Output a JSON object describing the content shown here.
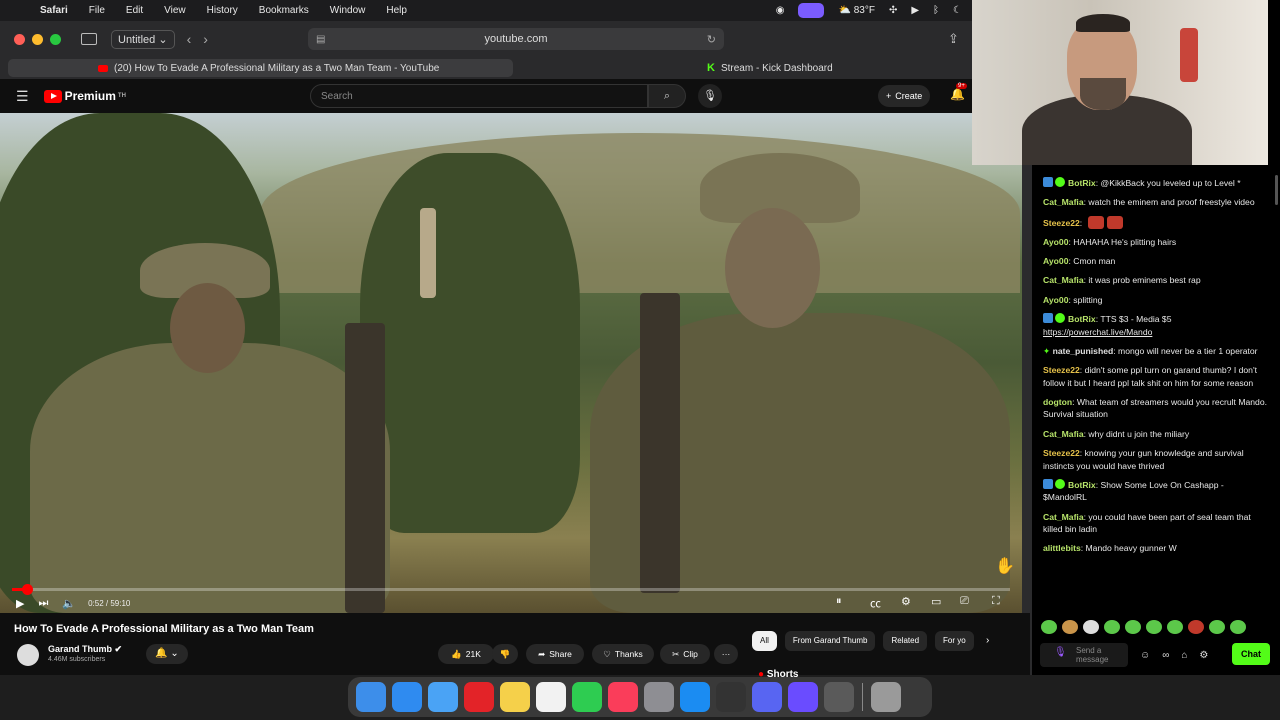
{
  "menubar": {
    "items": [
      "Safari",
      "File",
      "Edit",
      "View",
      "History",
      "Bookmarks",
      "Window",
      "Help"
    ],
    "weather": "83°F"
  },
  "browser": {
    "tab_group": "Untitled",
    "url": "youtube.com",
    "tabs": [
      {
        "title": "(20) How To Evade A Professional Military as a Two Man Team - YouTube",
        "active": true
      },
      {
        "title": "Stream - Kick Dashboard",
        "active": false
      }
    ]
  },
  "youtube": {
    "logo_text": "Premium",
    "logo_sup": "TH",
    "search_placeholder": "Search",
    "create_label": "Create",
    "notif_badge": "9+",
    "player": {
      "current_time": "0:52",
      "duration": "59:10",
      "time_display": "0:52 / 59:10",
      "progress_fraction": 0.0146
    },
    "video_title": "How To Evade A Professional Military as a Two Man Team",
    "channel_name": "Garand Thumb",
    "subscribers": "4.46M subscribers",
    "likes": "21K",
    "share_label": "Share",
    "thanks_label": "Thanks",
    "clip_label": "Clip",
    "more_label": "···",
    "chips": [
      "All",
      "From Garand Thumb",
      "Related",
      "For yo"
    ],
    "shorts_label": "Shorts"
  },
  "chat": {
    "messages": [
      {
        "user": "BotRix",
        "text": "@KikkBack you leveled up to Level *",
        "color": "#b7e36a",
        "badges": [
          "bot",
          "verified"
        ]
      },
      {
        "user": "Cat_Mafia",
        "text": "watch the eminem and proof freestyle video",
        "color": "#b7e36a",
        "badges": []
      },
      {
        "user": "Steeze22",
        "text": "",
        "color": "#e6c24a",
        "badges": [],
        "emotes": 2
      },
      {
        "user": "Ayo00",
        "text": "HAHAHA He's plitting hairs",
        "color": "#b7e36a",
        "badges": []
      },
      {
        "user": "Ayo00",
        "text": "Cmon man",
        "color": "#b7e36a",
        "badges": []
      },
      {
        "user": "Cat_Mafia",
        "text": "it was prob eminems best rap",
        "color": "#b7e36a",
        "badges": []
      },
      {
        "user": "Ayo00",
        "text": "splitting",
        "color": "#b7e36a",
        "badges": []
      },
      {
        "user": "BotRix",
        "text": "TTS $3 - Media $5",
        "link": "https://powerchat.live/Mando",
        "color": "#b7e36a",
        "badges": [
          "bot",
          "verified"
        ]
      },
      {
        "user": "nate_punished",
        "text": "mongo will never be a tier 1 operator",
        "color": "#e0e0e0",
        "badges": [
          "star"
        ]
      },
      {
        "user": "Steeze22",
        "text": "didn't some ppl turn on garand thumb? I don't follow it but I heard ppl talk shit on him for some reason",
        "color": "#e6c24a",
        "badges": []
      },
      {
        "user": "dogton",
        "text": "What team of streamers would you recrult Mando. Survival situation",
        "color": "#b7e36a",
        "badges": []
      },
      {
        "user": "Cat_Mafia",
        "text": "why didnt u join the miliary",
        "color": "#b7e36a",
        "badges": []
      },
      {
        "user": "Steeze22",
        "text": "knowing your gun knowledge and survival instincts you would have thrived",
        "color": "#e6c24a",
        "badges": []
      },
      {
        "user": "BotRix",
        "text": "Show Some Love On Cashapp - $MandolRL",
        "color": "#b7e36a",
        "badges": [
          "bot",
          "verified"
        ]
      },
      {
        "user": "Cat_Mafia",
        "text": "you could have been part of seal team that killed bin ladin",
        "color": "#b7e36a",
        "badges": []
      },
      {
        "user": "alittlebits",
        "text": "Mando heavy gunner W",
        "color": "#b7e36a",
        "badges": []
      }
    ],
    "input_placeholder": "Send a message",
    "send_label": "Chat"
  },
  "colors": {
    "yt_red": "#ff0000",
    "kick_green": "#53fc18"
  }
}
